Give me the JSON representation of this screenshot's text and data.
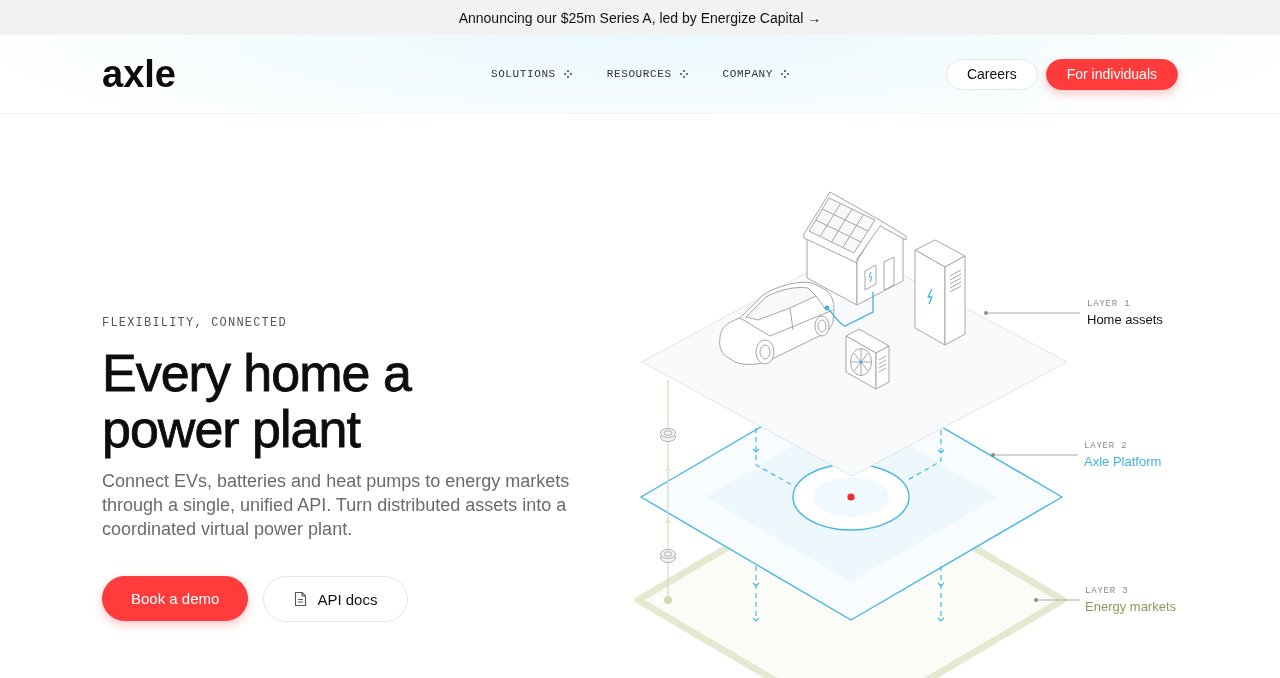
{
  "announcement": {
    "text": "Announcing our $25m Series A, led by Energize Capital →"
  },
  "nav": {
    "logo": "axle",
    "menu": [
      {
        "label": "SOLUTIONS"
      },
      {
        "label": "RESOURCES"
      },
      {
        "label": "COMPANY"
      }
    ],
    "buttons": [
      {
        "label": "Careers",
        "kind": "outline"
      },
      {
        "label": "For individuals",
        "kind": "primary"
      }
    ]
  },
  "hero": {
    "eyebrow": "FLEXIBILITY, CONNECTED",
    "title": "Every home a power plant",
    "description": "Connect EVs, batteries and heat pumps to energy markets through a single, unified API. Turn distributed assets into a coordinated virtual power plant.",
    "actions": [
      {
        "label": "Book a demo",
        "kind": "primary"
      },
      {
        "label": "API docs",
        "kind": "docs"
      }
    ]
  },
  "diagram": {
    "layers": [
      {
        "tag": "LAYER 1",
        "name": "Home assets",
        "color": "#111111"
      },
      {
        "tag": "LAYER 2",
        "name": "Axle Platform",
        "color": "#3db3e3"
      },
      {
        "tag": "LAYER 3",
        "name": "Energy markets",
        "color": "#8a9a5b"
      }
    ]
  }
}
